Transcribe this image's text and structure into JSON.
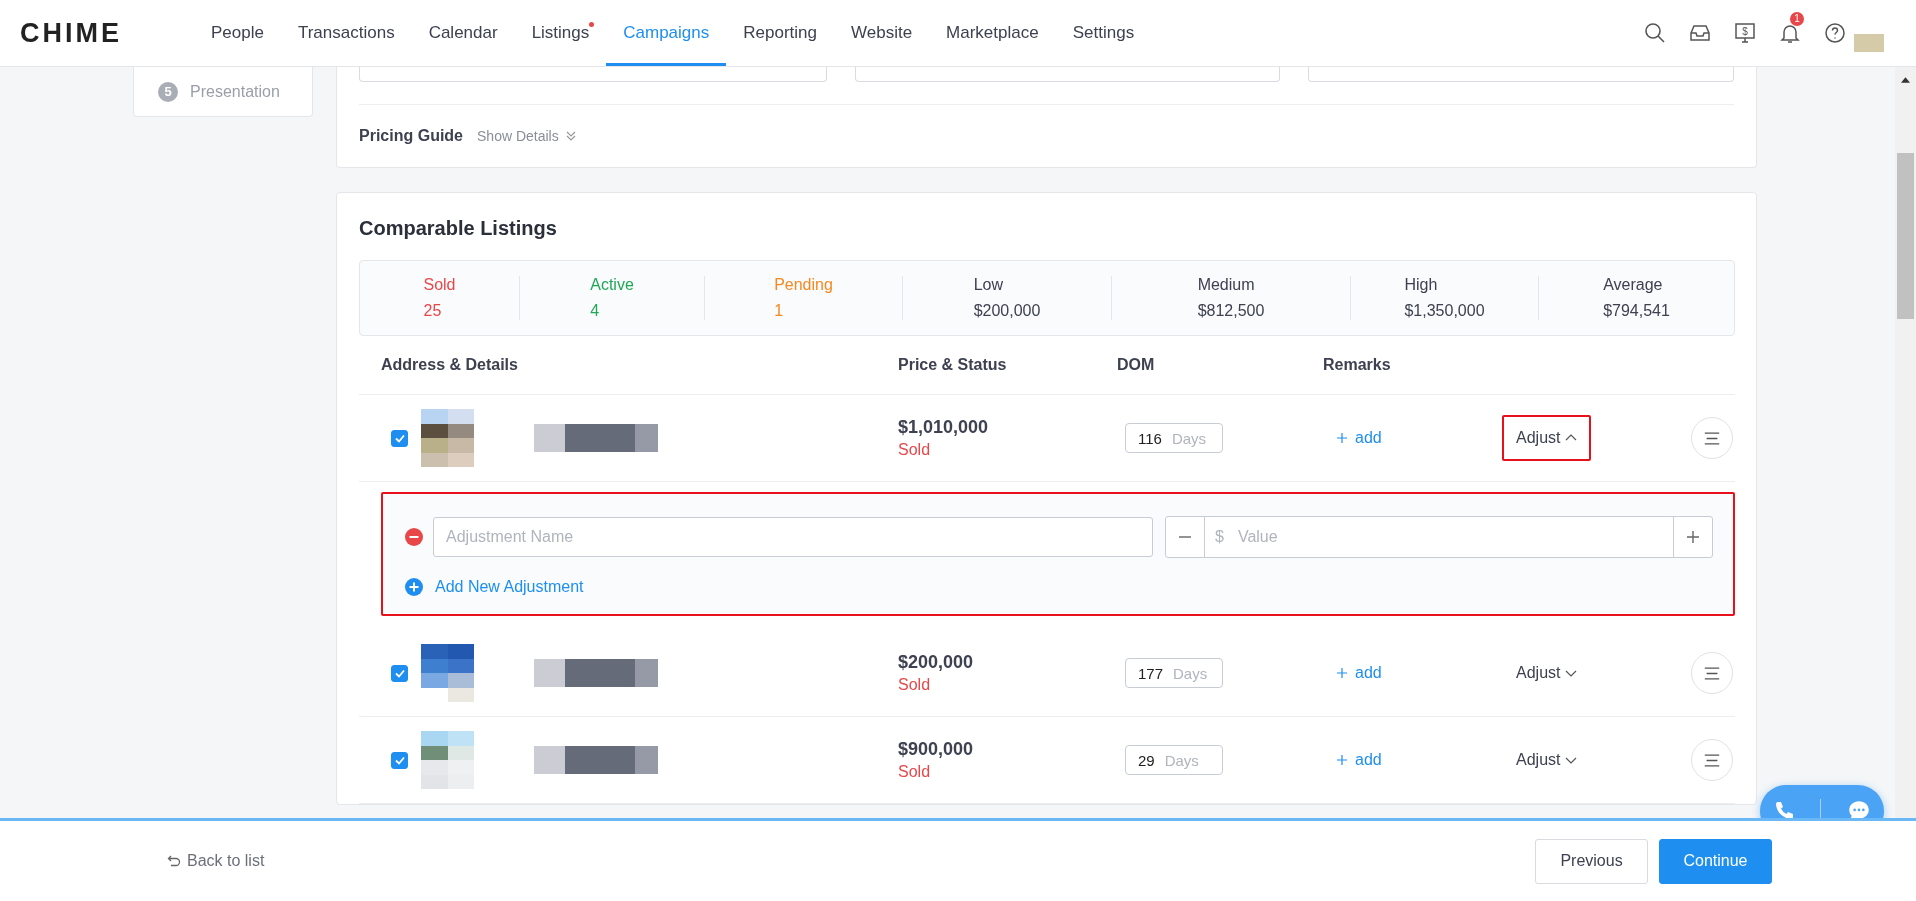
{
  "nav": {
    "logo": "CHIME",
    "items": [
      {
        "label": "People",
        "selected": false,
        "dot": false
      },
      {
        "label": "Transactions",
        "selected": false,
        "dot": false
      },
      {
        "label": "Calendar",
        "selected": false,
        "dot": false
      },
      {
        "label": "Listings",
        "selected": false,
        "dot": true
      },
      {
        "label": "Campaigns",
        "selected": true,
        "dot": false
      },
      {
        "label": "Reporting",
        "selected": false,
        "dot": false
      },
      {
        "label": "Website",
        "selected": false,
        "dot": false
      },
      {
        "label": "Marketplace",
        "selected": false,
        "dot": false
      },
      {
        "label": "Settings",
        "selected": false,
        "dot": false
      }
    ],
    "notification_count": "1",
    "billing_symbol": "$"
  },
  "steps": [
    {
      "number": "5",
      "label": "Presentation"
    }
  ],
  "pricing_guide": {
    "label": "Pricing Guide",
    "toggle": "Show Details"
  },
  "comparable": {
    "title": "Comparable Listings",
    "stats": [
      {
        "label": "Sold",
        "value": "25",
        "color": "#e8474a"
      },
      {
        "label": "Active",
        "value": "4",
        "color": "#1fa855"
      },
      {
        "label": "Pending",
        "value": "1",
        "color": "#f5891f"
      },
      {
        "label": "Low",
        "value": "$200,000",
        "color": "#3d4150"
      },
      {
        "label": "Medium",
        "value": "$812,500",
        "color": "#3d4150"
      },
      {
        "label": "High",
        "value": "$1,350,000",
        "color": "#3d4150"
      },
      {
        "label": "Average",
        "value": "$794,541",
        "color": "#3d4150"
      }
    ],
    "columns": [
      "Address & Details",
      "Price & Status",
      "DOM",
      "Remarks"
    ],
    "rows": [
      {
        "checked": true,
        "price": "$1,010,000",
        "status": "Sold",
        "dom": "116",
        "dom_unit": "Days",
        "remarks_action": "add",
        "adjust_label": "Adjust",
        "expanded": true,
        "highlighted": true
      },
      {
        "checked": true,
        "price": "$200,000",
        "status": "Sold",
        "dom": "177",
        "dom_unit": "Days",
        "remarks_action": "add",
        "adjust_label": "Adjust",
        "expanded": false,
        "highlighted": false
      },
      {
        "checked": true,
        "price": "$900,000",
        "status": "Sold",
        "dom": "29",
        "dom_unit": "Days",
        "remarks_action": "add",
        "adjust_label": "Adjust",
        "expanded": false,
        "highlighted": false
      }
    ],
    "adjustment": {
      "name_placeholder": "Adjustment Name",
      "currency": "$",
      "value_placeholder": "Value",
      "add_label": "Add New Adjustment",
      "highlighted": true
    }
  },
  "footer": {
    "back": "Back to list",
    "buttons": [
      {
        "label": "Previous",
        "kind": "secondary"
      },
      {
        "label": "Continue",
        "kind": "primary"
      }
    ]
  }
}
